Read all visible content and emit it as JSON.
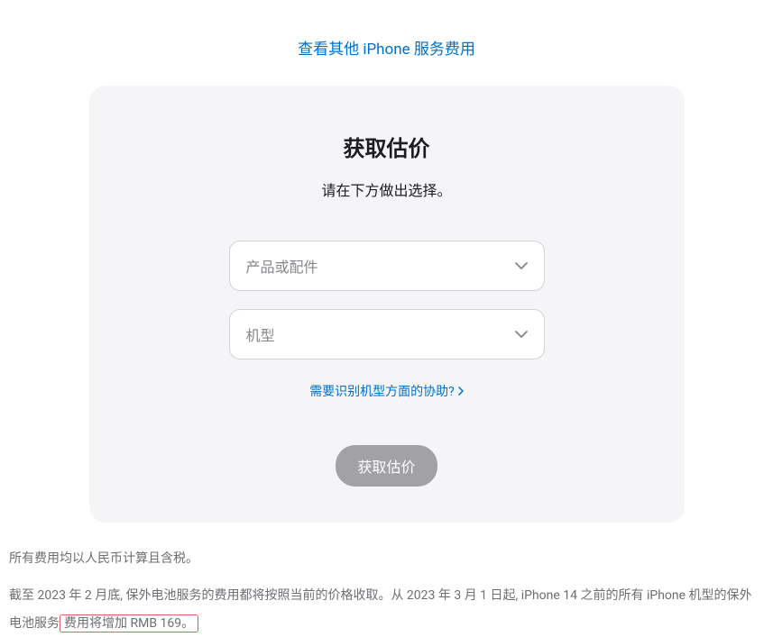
{
  "topLink": "查看其他 iPhone 服务费用",
  "card": {
    "title": "获取估价",
    "subtitle": "请在下方做出选择。",
    "select1Placeholder": "产品或配件",
    "select2Placeholder": "机型",
    "helpLink": "需要识别机型方面的协助?",
    "submit": "获取估价"
  },
  "footer": {
    "line1": "所有费用均以人民币计算且含税。",
    "line2Part1": "截至 2023 年 2 月底, 保外电池服务的费用都将按照当前的价格收取。从 2023 年 3 月 1 日起, iPhone 14 之前的所有 iPhone 机型的保外电池服务",
    "line2Highlight": "费用将增加 RMB 169。"
  }
}
